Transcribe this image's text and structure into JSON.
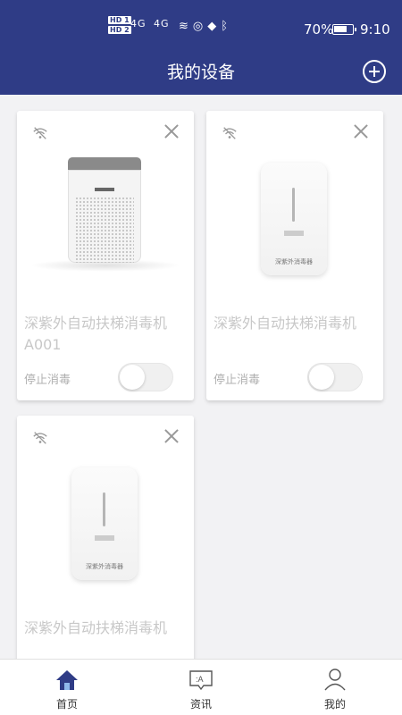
{
  "status_bar": {
    "hd1": "HD 1",
    "hd2": "HD 2",
    "net1": "4G",
    "net2": "4G",
    "battery": "70%",
    "time": "9:10"
  },
  "header": {
    "title": "我的设备"
  },
  "devices": [
    {
      "name": "深紫外自动扶梯消毒机 A001",
      "status": "停止消毒",
      "image": "air-purifier",
      "toggle_on": false
    },
    {
      "name": "深紫外自动扶梯消毒机",
      "status": "停止消毒",
      "image": "uv-sterilizer",
      "label": "深紫外消毒器",
      "toggle_on": false
    },
    {
      "name": "深紫外自动扶梯消毒机",
      "image": "uv-sterilizer",
      "label": "深紫外消毒器"
    }
  ],
  "tabbar": {
    "items": [
      {
        "label": "首页",
        "icon": "home-icon",
        "active": true
      },
      {
        "label": "资讯",
        "icon": "news-icon",
        "active": false
      },
      {
        "label": "我的",
        "icon": "profile-icon",
        "active": false
      }
    ],
    "active_color": "#2f3c86"
  }
}
